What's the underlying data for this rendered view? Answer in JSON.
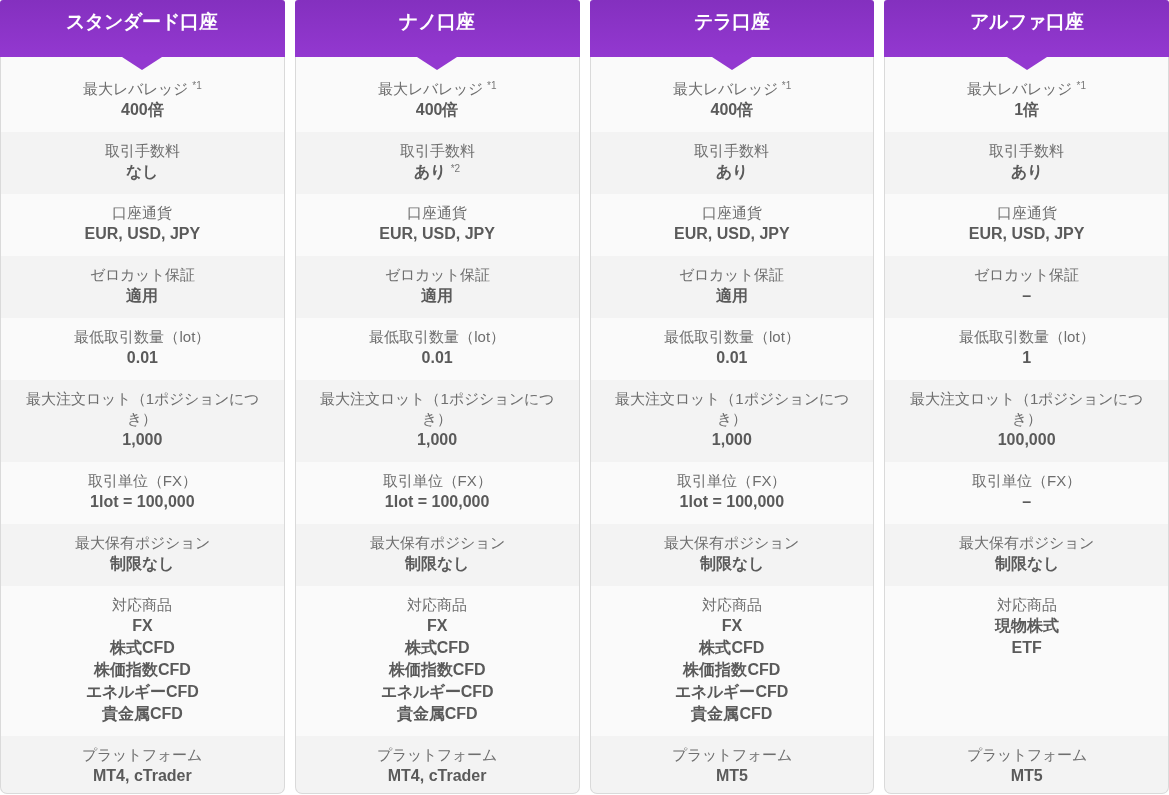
{
  "accounts": [
    {
      "title": "スタンダード口座",
      "specs": [
        {
          "label": "最大レバレッジ $^{*1}$",
          "values": [
            "400倍"
          ]
        },
        {
          "label": "取引手数料",
          "values": [
            "なし"
          ]
        },
        {
          "label": "口座通貨",
          "values": [
            "EUR, USD, JPY"
          ]
        },
        {
          "label": "ゼロカット保証",
          "values": [
            "適用"
          ]
        },
        {
          "label": "最低取引数量（lot）",
          "values": [
            "0.01"
          ]
        },
        {
          "label": "最大注文ロット（1ポジションにつき）",
          "values": [
            "1,000"
          ]
        },
        {
          "label": "取引単位（FX）",
          "values": [
            "1lot = 100,000"
          ]
        },
        {
          "label": "最大保有ポジション",
          "values": [
            "制限なし"
          ]
        },
        {
          "label": "対応商品",
          "values": [
            "FX",
            "株式CFD",
            "株価指数CFD",
            "エネルギーCFD",
            "貴金属CFD"
          ]
        },
        {
          "label": "プラットフォーム",
          "values": [
            "MT4, cTrader"
          ]
        }
      ]
    },
    {
      "title": "ナノ口座",
      "specs": [
        {
          "label": "最大レバレッジ $^{*1}$",
          "values": [
            "400倍"
          ]
        },
        {
          "label": "取引手数料",
          "values": [
            "あり $^{*2}$"
          ]
        },
        {
          "label": "口座通貨",
          "values": [
            "EUR, USD, JPY"
          ]
        },
        {
          "label": "ゼロカット保証",
          "values": [
            "適用"
          ]
        },
        {
          "label": "最低取引数量（lot）",
          "values": [
            "0.01"
          ]
        },
        {
          "label": "最大注文ロット（1ポジションにつき）",
          "values": [
            "1,000"
          ]
        },
        {
          "label": "取引単位（FX）",
          "values": [
            "1lot = 100,000"
          ]
        },
        {
          "label": "最大保有ポジション",
          "values": [
            "制限なし"
          ]
        },
        {
          "label": "対応商品",
          "values": [
            "FX",
            "株式CFD",
            "株価指数CFD",
            "エネルギーCFD",
            "貴金属CFD"
          ]
        },
        {
          "label": "プラットフォーム",
          "values": [
            "MT4, cTrader"
          ]
        }
      ]
    },
    {
      "title": "テラ口座",
      "specs": [
        {
          "label": "最大レバレッジ $^{*1}$",
          "values": [
            "400倍"
          ]
        },
        {
          "label": "取引手数料",
          "values": [
            "あり"
          ]
        },
        {
          "label": "口座通貨",
          "values": [
            "EUR, USD, JPY"
          ]
        },
        {
          "label": "ゼロカット保証",
          "values": [
            "適用"
          ]
        },
        {
          "label": "最低取引数量（lot）",
          "values": [
            "0.01"
          ]
        },
        {
          "label": "最大注文ロット（1ポジションにつき）",
          "values": [
            "1,000"
          ]
        },
        {
          "label": "取引単位（FX）",
          "values": [
            "1lot = 100,000"
          ]
        },
        {
          "label": "最大保有ポジション",
          "values": [
            "制限なし"
          ]
        },
        {
          "label": "対応商品",
          "values": [
            "FX",
            "株式CFD",
            "株価指数CFD",
            "エネルギーCFD",
            "貴金属CFD"
          ]
        },
        {
          "label": "プラットフォーム",
          "values": [
            "MT5"
          ]
        }
      ]
    },
    {
      "title": "アルファ口座",
      "specs": [
        {
          "label": "最大レバレッジ $^{*1}$",
          "values": [
            "1倍"
          ]
        },
        {
          "label": "取引手数料",
          "values": [
            "あり"
          ]
        },
        {
          "label": "口座通貨",
          "values": [
            "EUR, USD, JPY"
          ]
        },
        {
          "label": "ゼロカット保証",
          "values": [
            "–"
          ]
        },
        {
          "label": "最低取引数量（lot）",
          "values": [
            "1"
          ]
        },
        {
          "label": "最大注文ロット（1ポジションにつき）",
          "values": [
            "100,000"
          ]
        },
        {
          "label": "取引単位（FX）",
          "values": [
            "–"
          ]
        },
        {
          "label": "最大保有ポジション",
          "values": [
            "制限なし"
          ]
        },
        {
          "label": "対応商品",
          "values": [
            "現物株式",
            "ETF"
          ]
        },
        {
          "label": "プラットフォーム",
          "values": [
            "MT5"
          ]
        }
      ]
    }
  ]
}
